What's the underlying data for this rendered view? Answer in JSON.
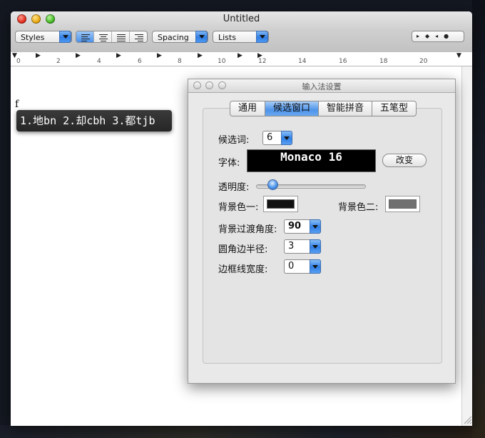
{
  "window": {
    "title": "Untitled",
    "toolbar": {
      "styles_label": "Styles",
      "spacing_label": "Spacing",
      "lists_label": "Lists",
      "nav_glyphs": "▸◆◂●"
    },
    "ruler_numbers": [
      "0",
      "2",
      "4",
      "6",
      "8",
      "10",
      "12",
      "14",
      "16",
      "18",
      "20"
    ],
    "document_text": "f",
    "candidate_bar": "1.地bn 2.却cbh 3.都tjb"
  },
  "ime_settings": {
    "title": "输入法设置",
    "tabs": [
      {
        "label": "通用",
        "active": false
      },
      {
        "label": "候选窗口",
        "active": true
      },
      {
        "label": "智能拼音",
        "active": false
      },
      {
        "label": "五笔型",
        "active": false
      }
    ],
    "candidate_count": {
      "label": "候选词:",
      "value": "6"
    },
    "font": {
      "label": "字体:",
      "preview": "Monaco 16",
      "change_button": "改变"
    },
    "transparency": {
      "label": "透明度:",
      "value": 0.12
    },
    "bg_color_1": {
      "label": "背景色一:",
      "color": "#111111"
    },
    "bg_color_2": {
      "label": "背景色二:",
      "color": "#707070"
    },
    "gradient_angle": {
      "label": "背景过渡角度:",
      "value": "90"
    },
    "corner_radius": {
      "label": "圆角边半径:",
      "value": "3"
    },
    "border_width": {
      "label": "边框线宽度:",
      "value": "0"
    }
  },
  "colors": {
    "accent": "#3b86ea",
    "candidate_bg": "#2e2e2e"
  }
}
